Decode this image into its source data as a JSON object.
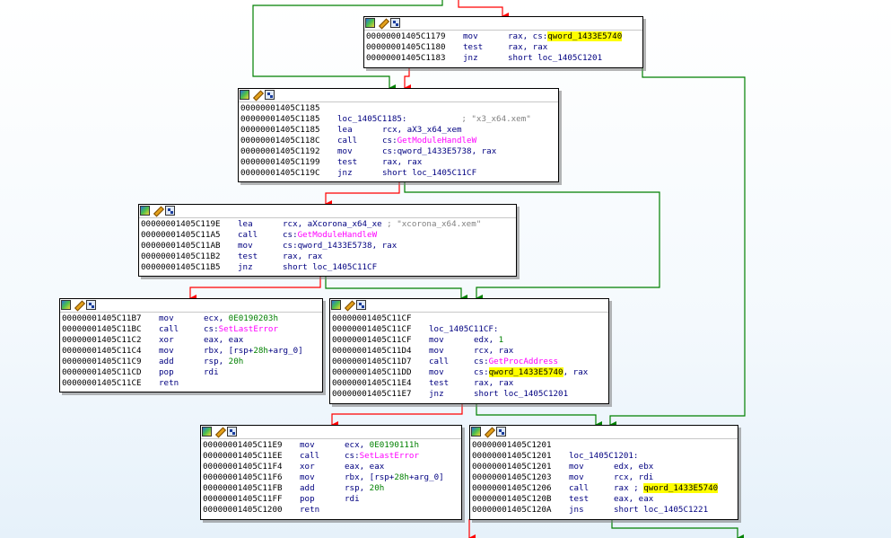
{
  "nodes": [
    {
      "id": "n1",
      "lines": [
        {
          "addr": "00000001405C1179",
          "mn": "mov",
          "ops": [
            {
              "t": "rax, cs:"
            },
            {
              "t": "qword_1433E5740",
              "c": "hl"
            }
          ]
        },
        {
          "addr": "00000001405C1180",
          "mn": "test",
          "ops": [
            {
              "t": "rax, rax"
            }
          ]
        },
        {
          "addr": "00000001405C1183",
          "mn": "jnz",
          "ops": [
            {
              "t": "short loc_1405C1201"
            }
          ]
        }
      ]
    },
    {
      "id": "n2",
      "lines": [
        {
          "addr": "00000001405C1185",
          "mn": "",
          "ops": []
        },
        {
          "addr": "00000001405C1185",
          "mn": "loc_1405C1185:",
          "ops": [
            {
              "t": "           "
            },
            {
              "t": "; \"x3_x64.xem\"",
              "c": "cm"
            }
          ],
          "is_label": true
        },
        {
          "addr": "00000001405C1185",
          "mn": "lea",
          "ops": [
            {
              "t": "rcx, aX3_x64_xem"
            }
          ]
        },
        {
          "addr": "00000001405C118C",
          "mn": "call",
          "ops": [
            {
              "t": "cs:"
            },
            {
              "t": "GetModuleHandleW",
              "c": "imp"
            }
          ]
        },
        {
          "addr": "00000001405C1192",
          "mn": "mov",
          "ops": [
            {
              "t": "cs:qword_1433E5738, rax"
            }
          ]
        },
        {
          "addr": "00000001405C1199",
          "mn": "test",
          "ops": [
            {
              "t": "rax, rax"
            }
          ]
        },
        {
          "addr": "00000001405C119C",
          "mn": "jnz",
          "ops": [
            {
              "t": "short loc_1405C11CF"
            }
          ]
        }
      ]
    },
    {
      "id": "n3",
      "lines": [
        {
          "addr": "00000001405C119E",
          "mn": "lea",
          "ops": [
            {
              "t": "rcx, aXcorona_x64_xe "
            },
            {
              "t": "; \"xcorona_x64.xem\"",
              "c": "cm"
            }
          ]
        },
        {
          "addr": "00000001405C11A5",
          "mn": "call",
          "ops": [
            {
              "t": "cs:"
            },
            {
              "t": "GetModuleHandleW",
              "c": "imp"
            }
          ]
        },
        {
          "addr": "00000001405C11AB",
          "mn": "mov",
          "ops": [
            {
              "t": "cs:qword_1433E5738, rax"
            }
          ]
        },
        {
          "addr": "00000001405C11B2",
          "mn": "test",
          "ops": [
            {
              "t": "rax, rax"
            }
          ]
        },
        {
          "addr": "00000001405C11B5",
          "mn": "jnz",
          "ops": [
            {
              "t": "short loc_1405C11CF"
            }
          ]
        }
      ]
    },
    {
      "id": "n4",
      "lines": [
        {
          "addr": "00000001405C11B7",
          "mn": "mov",
          "ops": [
            {
              "t": "ecx, "
            },
            {
              "t": "0E0190203h",
              "c": "num"
            }
          ]
        },
        {
          "addr": "00000001405C11BC",
          "mn": "call",
          "ops": [
            {
              "t": "cs:"
            },
            {
              "t": "SetLastError",
              "c": "imp"
            }
          ]
        },
        {
          "addr": "00000001405C11C2",
          "mn": "xor",
          "ops": [
            {
              "t": "eax, eax"
            }
          ]
        },
        {
          "addr": "00000001405C11C4",
          "mn": "mov",
          "ops": [
            {
              "t": "rbx, [rsp+"
            },
            {
              "t": "28h",
              "c": "num"
            },
            {
              "t": "+arg_0]"
            }
          ]
        },
        {
          "addr": "00000001405C11C9",
          "mn": "add",
          "ops": [
            {
              "t": "rsp, "
            },
            {
              "t": "20h",
              "c": "num"
            }
          ]
        },
        {
          "addr": "00000001405C11CD",
          "mn": "pop",
          "ops": [
            {
              "t": "rdi"
            }
          ]
        },
        {
          "addr": "00000001405C11CE",
          "mn": "retn",
          "ops": []
        }
      ]
    },
    {
      "id": "n5",
      "lines": [
        {
          "addr": "00000001405C11CF",
          "mn": "",
          "ops": []
        },
        {
          "addr": "00000001405C11CF",
          "mn": "loc_1405C11CF:",
          "ops": [],
          "is_label": true
        },
        {
          "addr": "00000001405C11CF",
          "mn": "mov",
          "ops": [
            {
              "t": "edx, "
            },
            {
              "t": "1",
              "c": "num"
            }
          ]
        },
        {
          "addr": "00000001405C11D4",
          "mn": "mov",
          "ops": [
            {
              "t": "rcx, rax"
            }
          ]
        },
        {
          "addr": "00000001405C11D7",
          "mn": "call",
          "ops": [
            {
              "t": "cs:"
            },
            {
              "t": "GetProcAddress",
              "c": "imp"
            }
          ]
        },
        {
          "addr": "00000001405C11DD",
          "mn": "mov",
          "ops": [
            {
              "t": "cs:"
            },
            {
              "t": "qword_1433E5740",
              "c": "hl"
            },
            {
              "t": ", rax"
            }
          ]
        },
        {
          "addr": "00000001405C11E4",
          "mn": "test",
          "ops": [
            {
              "t": "rax, rax"
            }
          ]
        },
        {
          "addr": "00000001405C11E7",
          "mn": "jnz",
          "ops": [
            {
              "t": "short loc_1405C1201"
            }
          ]
        }
      ]
    },
    {
      "id": "n6",
      "lines": [
        {
          "addr": "00000001405C11E9",
          "mn": "mov",
          "ops": [
            {
              "t": "ecx, "
            },
            {
              "t": "0E0190111h",
              "c": "num"
            }
          ]
        },
        {
          "addr": "00000001405C11EE",
          "mn": "call",
          "ops": [
            {
              "t": "cs:"
            },
            {
              "t": "SetLastError",
              "c": "imp"
            }
          ]
        },
        {
          "addr": "00000001405C11F4",
          "mn": "xor",
          "ops": [
            {
              "t": "eax, eax"
            }
          ]
        },
        {
          "addr": "00000001405C11F6",
          "mn": "mov",
          "ops": [
            {
              "t": "rbx, [rsp+"
            },
            {
              "t": "28h",
              "c": "num"
            },
            {
              "t": "+arg_0]"
            }
          ]
        },
        {
          "addr": "00000001405C11FB",
          "mn": "add",
          "ops": [
            {
              "t": "rsp, "
            },
            {
              "t": "20h",
              "c": "num"
            }
          ]
        },
        {
          "addr": "00000001405C11FF",
          "mn": "pop",
          "ops": [
            {
              "t": "rdi"
            }
          ]
        },
        {
          "addr": "00000001405C1200",
          "mn": "retn",
          "ops": []
        }
      ]
    },
    {
      "id": "n7",
      "lines": [
        {
          "addr": "00000001405C1201",
          "mn": "",
          "ops": []
        },
        {
          "addr": "00000001405C1201",
          "mn": "loc_1405C1201:",
          "ops": [],
          "is_label": true
        },
        {
          "addr": "00000001405C1201",
          "mn": "mov",
          "ops": [
            {
              "t": "edx, ebx"
            }
          ]
        },
        {
          "addr": "00000001405C1203",
          "mn": "mov",
          "ops": [
            {
              "t": "rcx, rdi"
            }
          ]
        },
        {
          "addr": "00000001405C1206",
          "mn": "call",
          "ops": [
            {
              "t": "rax ; "
            },
            {
              "t": "qword_1433E5740",
              "c": "hl"
            }
          ]
        },
        {
          "addr": "00000001405C120B",
          "mn": "test",
          "ops": [
            {
              "t": "eax, eax"
            }
          ]
        },
        {
          "addr": "00000001405C120A",
          "mn": "jns",
          "ops": [
            {
              "t": "short loc_1405C1221"
            }
          ]
        }
      ]
    }
  ],
  "edge_colors": {
    "taken": "#008000",
    "not_taken": "#ff0000"
  }
}
